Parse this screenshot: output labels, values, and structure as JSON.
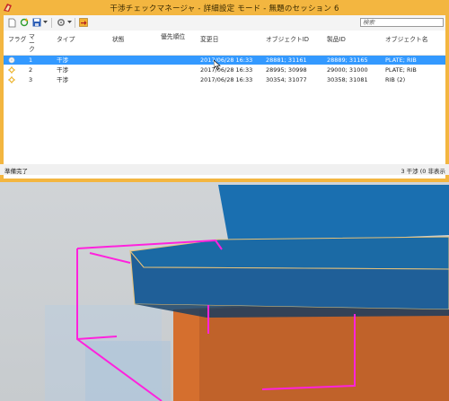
{
  "window": {
    "title": "干渉チェックマネージャ - 詳細設定 モード - 無題のセッション 6"
  },
  "toolbar": {
    "search_placeholder": "検索",
    "icons": [
      "new-icon",
      "refresh-icon",
      "save-icon",
      "dropdown-icon",
      "settings-icon",
      "dropdown-icon",
      "export-icon"
    ]
  },
  "columns": [
    "フラグ",
    "マーク",
    "タイプ",
    "状態",
    "優先順位",
    "変更日",
    "オブジェクトID",
    "製品ID",
    "オブジェクト名"
  ],
  "rows": [
    {
      "mark": "1",
      "type": "干渉",
      "status": "",
      "priority": "",
      "date": "2017/06/28 16:33",
      "object_id": "28881; 31161",
      "product_id": "28889; 31165",
      "name": "PLATE; RIB",
      "selected": true
    },
    {
      "mark": "2",
      "type": "干渉",
      "status": "",
      "priority": "",
      "date": "2017/06/28 16:33",
      "object_id": "28995; 30998",
      "product_id": "29000; 31000",
      "name": "PLATE; RIB",
      "selected": false
    },
    {
      "mark": "3",
      "type": "干渉",
      "status": "",
      "priority": "",
      "date": "2017/06/28 16:33",
      "object_id": "30354; 31077",
      "product_id": "30358; 31081",
      "name": "RIB (2)",
      "selected": false
    }
  ],
  "status_bar": {
    "text": "準備完了",
    "count": "3 干渉 (0 非表示"
  },
  "colors": {
    "title_bar": "#f3b640",
    "selection": "#3399ff",
    "plate": "#1b6aa5",
    "rib": "#c9692c",
    "highlight": "#ff22dd"
  }
}
